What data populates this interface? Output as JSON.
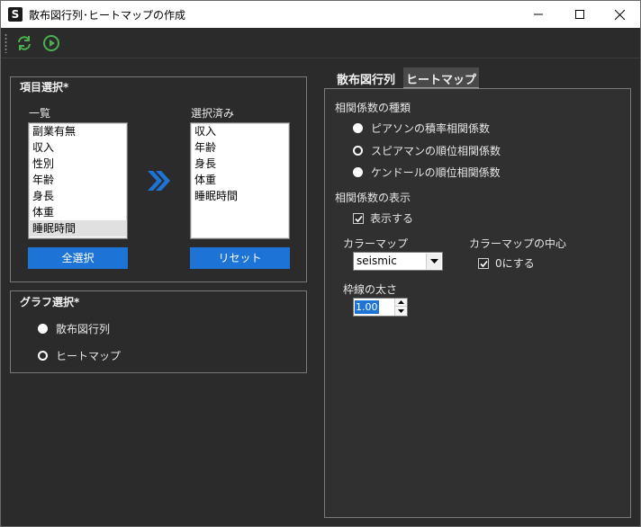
{
  "window": {
    "app_icon": "S",
    "title": "散布図行列･ヒートマップの作成",
    "controls": [
      "minimize-icon",
      "maximize-icon",
      "close-icon"
    ]
  },
  "toolbar": {
    "icons": [
      "refresh-icon",
      "play-icon"
    ],
    "accent": "#4caf50"
  },
  "item_select": {
    "title": "項目選択*",
    "available_label": "一覧",
    "available": [
      "副業有無",
      "収入",
      "性別",
      "年齢",
      "身長",
      "体重",
      "睡眠時間"
    ],
    "available_selected": "睡眠時間",
    "move_icon": "double-chevron-right-icon",
    "selected_label": "選択済み",
    "selected": [
      "収入",
      "年齢",
      "身長",
      "体重",
      "睡眠時間"
    ],
    "select_all_button": "全選択",
    "reset_button": "リセット",
    "button_color": "#1e73d6"
  },
  "graph_select": {
    "title": "グラフ選択*",
    "options": [
      {
        "label": "散布図行列",
        "checked": false
      },
      {
        "label": "ヒートマップ",
        "checked": true
      }
    ]
  },
  "tabs": [
    {
      "label": "散布図行列",
      "active": false
    },
    {
      "label": "ヒートマップ",
      "active": true
    }
  ],
  "heatmap_settings": {
    "corr_type_label": "相関係数の種類",
    "corr_types": [
      {
        "label": "ピアソンの積率相関係数",
        "checked": false
      },
      {
        "label": "スピアマンの順位相関係数",
        "checked": true
      },
      {
        "label": "ケンドールの順位相関係数",
        "checked": false
      }
    ],
    "corr_display_label": "相関係数の表示",
    "show_checkbox": {
      "label": "表示する",
      "checked": true
    },
    "colormap_label": "カラーマップ",
    "colormap_value": "seismic",
    "colormap_center_label": "カラーマップの中心",
    "center_zero_checkbox": {
      "label": "0にする",
      "checked": true
    },
    "border_width_label": "枠線の太さ",
    "border_width_value": "1.00"
  }
}
